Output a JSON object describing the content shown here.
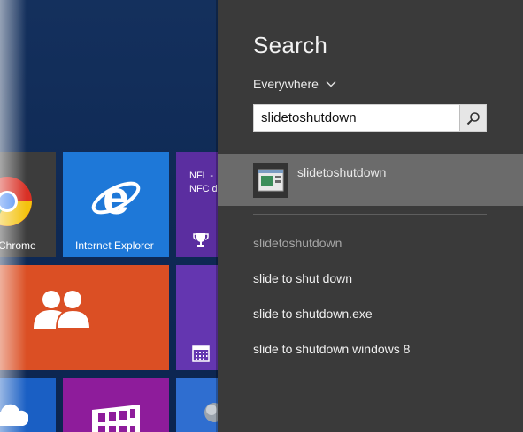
{
  "start_screen": {
    "tiles": {
      "chrome": {
        "label": "Chrome",
        "color": "#3c3c3c"
      },
      "internet_explorer": {
        "label": "Internet Explorer",
        "color": "#1e78d8"
      },
      "nfl": {
        "line1": "NFL -",
        "line2": "NFC d",
        "color": "#5b2ea0"
      },
      "people": {
        "color": "#db4f24"
      },
      "calendar": {
        "color": "#6436b0"
      },
      "skydrive": {
        "color": "#1a5fc4"
      },
      "store": {
        "color": "#8e1c9b"
      },
      "weather": {
        "color": "#2f6ed0"
      }
    }
  },
  "search": {
    "title": "Search",
    "scope": "Everywhere",
    "query": "slidetoshutdown",
    "top_result": {
      "label": "slidetoshutdown",
      "icon": "desktop-app-icon"
    },
    "suggestions": [
      "slidetoshutdown",
      "slide to shut down",
      "slide to shutdown.exe",
      "slide to shutdown windows 8"
    ],
    "colors": {
      "pane": "#3a3a3a",
      "highlight": "#6b6b6b"
    }
  }
}
